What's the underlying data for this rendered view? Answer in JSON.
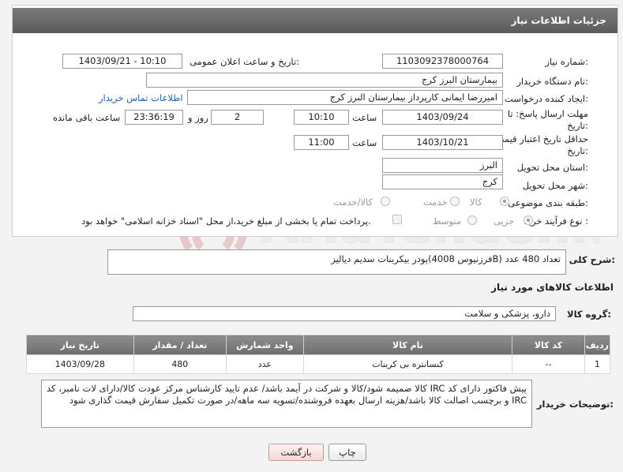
{
  "header": {
    "title": "جزئیات اطلاعات نیاز"
  },
  "form": {
    "need_number_label": "شماره نیاز:",
    "need_number": "1103092378000764",
    "announce_label": "تاریخ و ساعت اعلان عمومی:",
    "announce_value": "1403/09/21 - 10:10",
    "buyer_org_label": "نام دستگاه خریدار:",
    "buyer_org": "بیمارستان البرز کرج",
    "creator_label": "ایجاد کننده درخواست:",
    "creator": "امیررضا ایمانی کارپرداز بیمارستان البرز کرج",
    "contact_link": "اطلاعات تماس خریدار",
    "deadline_label_1": "مهلت ارسال پاسخ: تا",
    "deadline_label_2": "تاریخ:",
    "deadline_date": "1403/09/24",
    "hour_label": "ساعت",
    "deadline_hour": "10:10",
    "days_value": "2",
    "days_label": "روز و",
    "remaining_time": "23:36:19",
    "remaining_label": "ساعت باقی مانده",
    "validity_label_1": "حداقل تاریخ اعتبار قیمت: تا",
    "validity_label_2": "تاریخ:",
    "validity_date": "1403/10/21",
    "validity_hour_label": "ساعت",
    "validity_hour": "11:00",
    "province_label": "استان محل تحویل:",
    "province": "البرز",
    "city_label": "شهر محل تحویل:",
    "city": "کرج",
    "category_label": "طبقه بندی موضوعی:",
    "category_options": [
      "کالا",
      "خدمت",
      "کالا/خدمت"
    ],
    "process_label": "نوع فرآیند خرید :",
    "process_options": [
      "جزیی",
      "متوسط"
    ],
    "payment_note": "پرداخت تمام یا بخشی از مبلغ خرید،از محل \"اسناد خزانه اسلامی\" خواهد بود."
  },
  "description": {
    "label": "شرح کلی نیاز:",
    "text": "پودر بیکربنات سدیم دیالیز(فرزنیوس 4008B) تعداد 480 عدد"
  },
  "goods_info": {
    "title": "اطلاعات کالاهای مورد نیاز",
    "group_label": "گروه کالا:",
    "group_value": "دارو، پزشکی و سلامت"
  },
  "table": {
    "headers": [
      "ردیف",
      "کد کالا",
      "نام کالا",
      "واحد شمارش",
      "تعداد / مقدار",
      "تاریخ نیاز"
    ],
    "rows": [
      [
        "1",
        "--",
        "کنسانتره بی کربنات",
        "عدد",
        "480",
        "1403/09/28"
      ]
    ]
  },
  "buyer_notes": {
    "label": "توضیحات خریدار:",
    "text": "پیش فاکتور دارای کد IRC کالا ضمیمه شود/کالا و شرکت در آیمد باشد/ عدم تایید کارشناس مرکز عودت کالا/دارای لات نامبر، کد IRC و برچسب اصالت کالا باشد/هزینه ارسال بعهده فروشنده/تسویه سه ماهه/در صورت تکمیل سفارش قیمت گذاری شود"
  },
  "buttons": {
    "print": "چاپ",
    "back": "بازگشت"
  },
  "watermark": {
    "text": "AriaTender.neT"
  }
}
